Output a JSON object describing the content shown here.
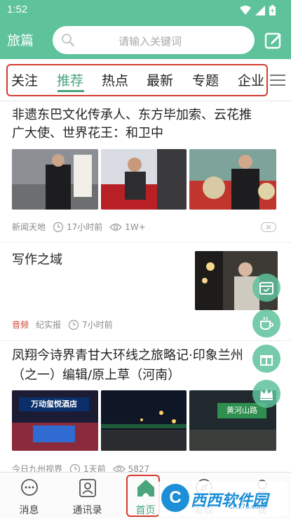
{
  "status_bar": {
    "time": "1:52"
  },
  "app_bar": {
    "title": "旅篇",
    "search_placeholder": "请输入关键词"
  },
  "tabs": [
    {
      "label": "关注",
      "active": false
    },
    {
      "label": "推荐",
      "active": true
    },
    {
      "label": "热点",
      "active": false
    },
    {
      "label": "最新",
      "active": false
    },
    {
      "label": "专题",
      "active": false
    },
    {
      "label": "企业",
      "active": false
    }
  ],
  "articles": [
    {
      "title_line1": "非遗东巴文化传承人、东方毕加索、云花推",
      "title_line2": "广大使、世界花王：和卫中",
      "source": "新闻天地",
      "time": "17小时前",
      "views": "1W+"
    },
    {
      "title": "写作之域",
      "tag": "音频",
      "source": "纪实报",
      "time": "7小时前"
    },
    {
      "title_line1": "凤翔今诗界青甘大环线之旅略记·印象兰州",
      "title_line2": "（之一）编辑/原上草（河南）",
      "source": "今日九州视界",
      "time": "1天前",
      "views": "5827",
      "image_sign_text": "万动玺悦酒店",
      "road_sign_text": "黄河山路"
    }
  ],
  "bottom_nav": [
    {
      "label": "消息"
    },
    {
      "label": "通讯录"
    },
    {
      "label": "首页"
    },
    {
      "label": "发现"
    },
    {
      "label": "我"
    }
  ],
  "watermark": {
    "text": "西西软件园",
    "sub": "CR173.com"
  },
  "colors": {
    "brand": "#5ec29b",
    "accent": "#4aa57d",
    "highlight": "#d43b2f"
  }
}
